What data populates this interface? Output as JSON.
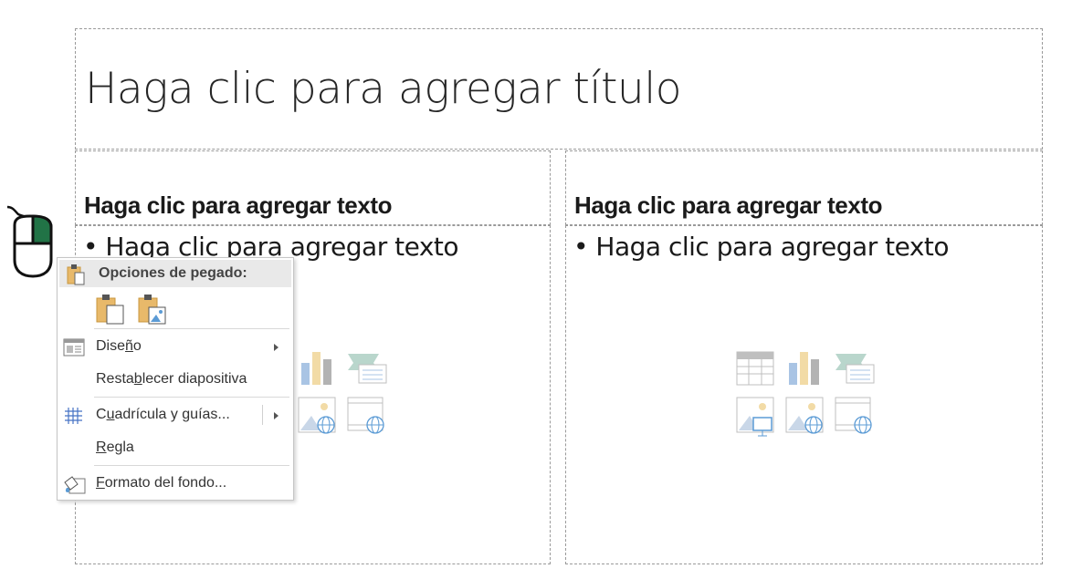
{
  "slide": {
    "title_placeholder": "Haga clic para agregar título",
    "left_header": "Haga clic para agregar texto",
    "right_header": "Haga clic para agregar texto",
    "left_body": "• Haga clic para agregar texto",
    "right_body": "• Haga clic para agregar texto",
    "content_icons": [
      "table-icon",
      "chart-icon",
      "smartart-icon",
      "picture-icon",
      "online-picture-icon",
      "video-icon"
    ]
  },
  "context_menu": {
    "paste_header": "Opciones de pegado:",
    "paste_options": [
      "keep-text-only",
      "picture"
    ],
    "items": [
      {
        "pre": "Dise",
        "key": "ñ",
        "post": "o",
        "has_submenu": true,
        "icon": "layout-icon"
      },
      {
        "pre": "Resta",
        "key": "b",
        "post": "lecer diapositiva",
        "has_submenu": false,
        "icon": ""
      },
      {
        "pre": "C",
        "key": "u",
        "post": "adrícula y guías...",
        "has_submenu": true,
        "icon": "grid-icon"
      },
      {
        "pre": "",
        "key": "R",
        "post": "egla",
        "has_submenu": false,
        "icon": ""
      },
      {
        "pre": "",
        "key": "F",
        "post": "ormato del fondo...",
        "has_submenu": false,
        "icon": "format-background-icon"
      }
    ]
  },
  "colors": {
    "mouse_button": "#217346",
    "menu_header_bg": "#e9e9e9",
    "placeholder_border": "#9a9a9a"
  }
}
